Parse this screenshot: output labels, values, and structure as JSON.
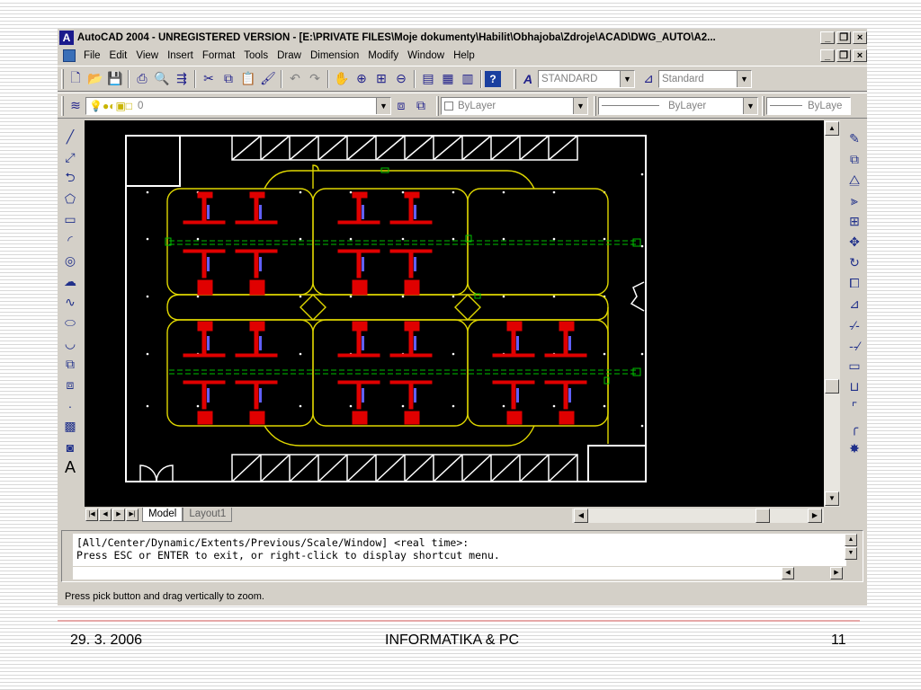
{
  "window": {
    "logo": "A",
    "title": "AutoCAD 2004 - UNREGISTERED VERSION - [E:\\PRIVATE FILES\\Moje dokumenty\\Habilit\\Obhajoba\\Zdroje\\ACAD\\DWG_AUTO\\A2...",
    "controls": {
      "minimize": "_",
      "restore": "❐",
      "close": "×"
    }
  },
  "menubar": {
    "items": [
      "File",
      "Edit",
      "View",
      "Insert",
      "Format",
      "Tools",
      "Draw",
      "Dimension",
      "Modify",
      "Window",
      "Help"
    ],
    "doc_controls": {
      "minimize": "_",
      "restore": "❐",
      "close": "×"
    }
  },
  "toolbar_standard": {
    "text_style_combo": "STANDARD",
    "dim_style_combo": "Standard"
  },
  "toolbar_layers": {
    "layer_combo": "0",
    "color_combo": "ByLayer",
    "linetype_combo": "ByLayer",
    "lineweight_combo": "ByLaye"
  },
  "layout_tabs": {
    "tabs": [
      "Model",
      "Layout1"
    ],
    "active": "Model"
  },
  "command": {
    "line1": "[All/Center/Dynamic/Extents/Previous/Scale/Window] <real time>:",
    "line2": "Press ESC or ENTER to exit, or right-click to display shortcut menu."
  },
  "status": {
    "text": "Press pick button and drag vertically to zoom."
  },
  "slide_footer": {
    "date": "29. 3. 2006",
    "center": "INFORMATIKA & PC",
    "page": "11"
  },
  "colors": {
    "drawing_background": "#000000",
    "border_lines": "#ffffff",
    "roads": "#e0d800",
    "vehicles": "#e00000",
    "axis": "#00c000",
    "ui_gray": "#d4d0c8"
  },
  "icons": {
    "standard_toolbar": [
      "new-icon",
      "open-icon",
      "save-icon",
      "print-icon",
      "preview-icon",
      "publish-icon",
      "cut-icon",
      "copy-icon",
      "paste-icon",
      "match-properties-icon",
      "undo-icon",
      "redo-icon",
      "pan-icon",
      "zoom-realtime-icon",
      "zoom-window-icon",
      "zoom-previous-icon",
      "properties-icon",
      "design-center-icon",
      "tool-palettes-icon",
      "help-icon"
    ],
    "draw_toolbar": [
      "line-icon",
      "construction-line-icon",
      "polyline-icon",
      "polygon-icon",
      "rectangle-icon",
      "arc-icon",
      "circle-icon",
      "revision-cloud-icon",
      "spline-icon",
      "ellipse-icon",
      "ellipse-arc-icon",
      "insert-block-icon",
      "make-block-icon",
      "point-icon",
      "hatch-icon",
      "region-icon",
      "multiline-text-icon"
    ],
    "modify_toolbar": [
      "erase-icon",
      "copy-object-icon",
      "mirror-icon",
      "offset-icon",
      "array-icon",
      "move-icon",
      "rotate-icon",
      "scale-icon",
      "stretch-icon",
      "trim-icon",
      "extend-icon",
      "break-at-point-icon",
      "break-icon",
      "chamfer-icon",
      "fillet-icon",
      "explode-icon"
    ]
  }
}
